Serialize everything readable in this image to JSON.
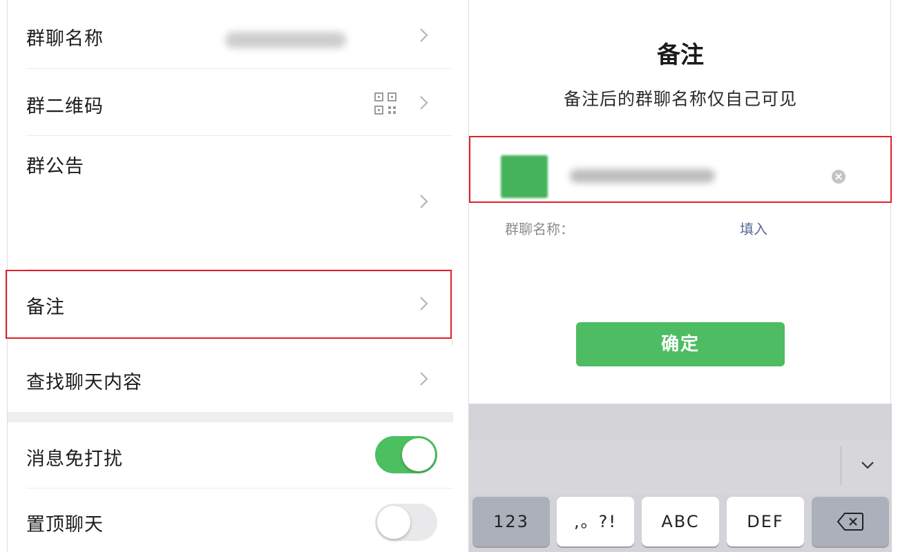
{
  "left_panel": {
    "rows": {
      "group_name": {
        "label": "群聊名称"
      },
      "group_qr": {
        "label": "群二维码"
      },
      "group_notice": {
        "label": "群公告"
      },
      "remark": {
        "label": "备注"
      },
      "search_chat": {
        "label": "查找聊天内容"
      },
      "mute": {
        "label": "消息免打扰",
        "toggle_on": true
      },
      "pin": {
        "label": "置顶聊天",
        "toggle_on": false
      }
    },
    "colors": {
      "toggle_on": "#4cbf60",
      "toggle_off": "#e9e9eb",
      "highlight": "#e0202b"
    }
  },
  "right_panel": {
    "dialog": {
      "title": "备注",
      "subtitle": "备注后的群聊名称仅自己可见",
      "hint_label": "群聊名称：",
      "fill_link": "填入",
      "confirm_button": "确定"
    },
    "keyboard": {
      "keys": [
        "123",
        ",。?!",
        "ABC",
        "DEF"
      ],
      "icons": [
        "collapse-keyboard-icon",
        "backspace-icon"
      ]
    },
    "colors": {
      "confirm": "#4dbc62",
      "link": "#576b95"
    }
  }
}
